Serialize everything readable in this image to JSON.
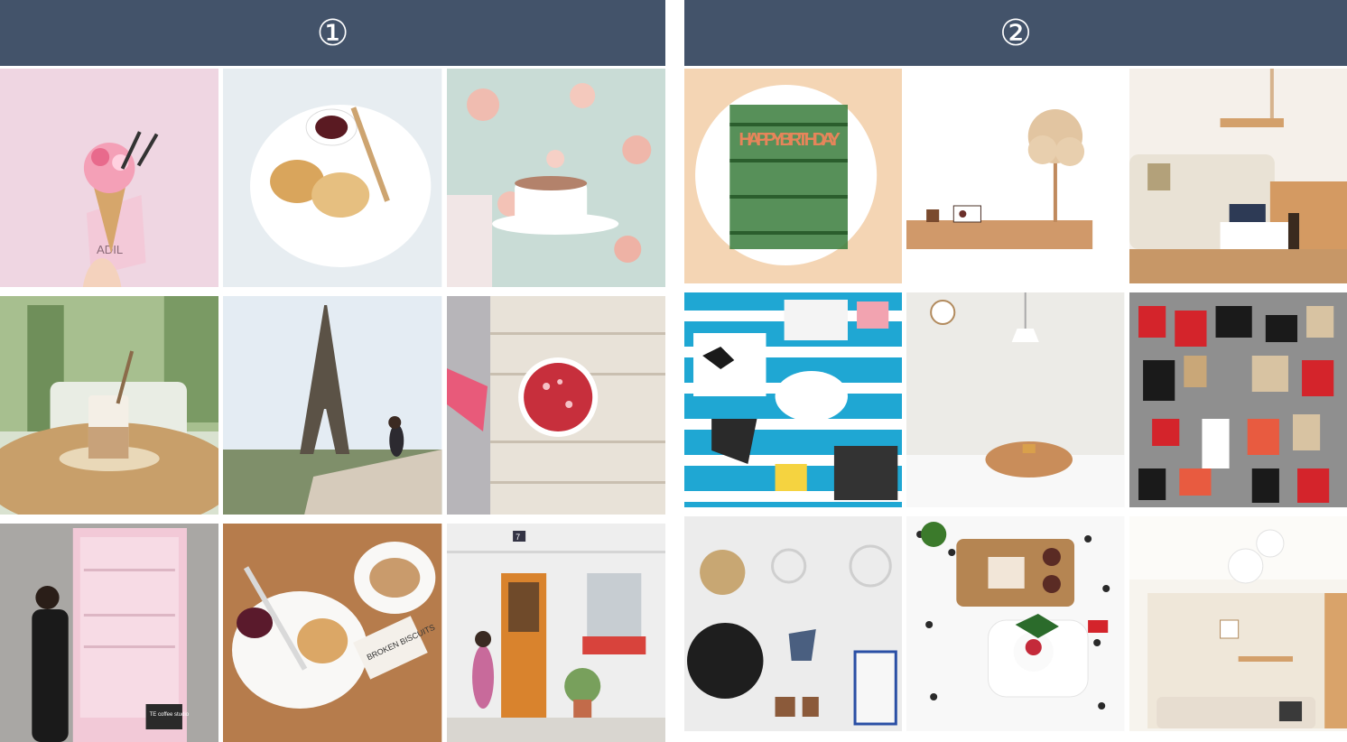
{
  "panels": [
    {
      "label": "①"
    },
    {
      "label": "②"
    }
  ],
  "tiles": {
    "ice_cream_sign": "ADIL",
    "birthday_text": "HAPPY BIRTHDAY",
    "biscuits_card": "BROKEN BISCUITS",
    "door_number": "7",
    "shop_sign": "TE coffee studio"
  },
  "colors": {
    "header_bg": "#43536a",
    "header_text": "#ffffff"
  }
}
